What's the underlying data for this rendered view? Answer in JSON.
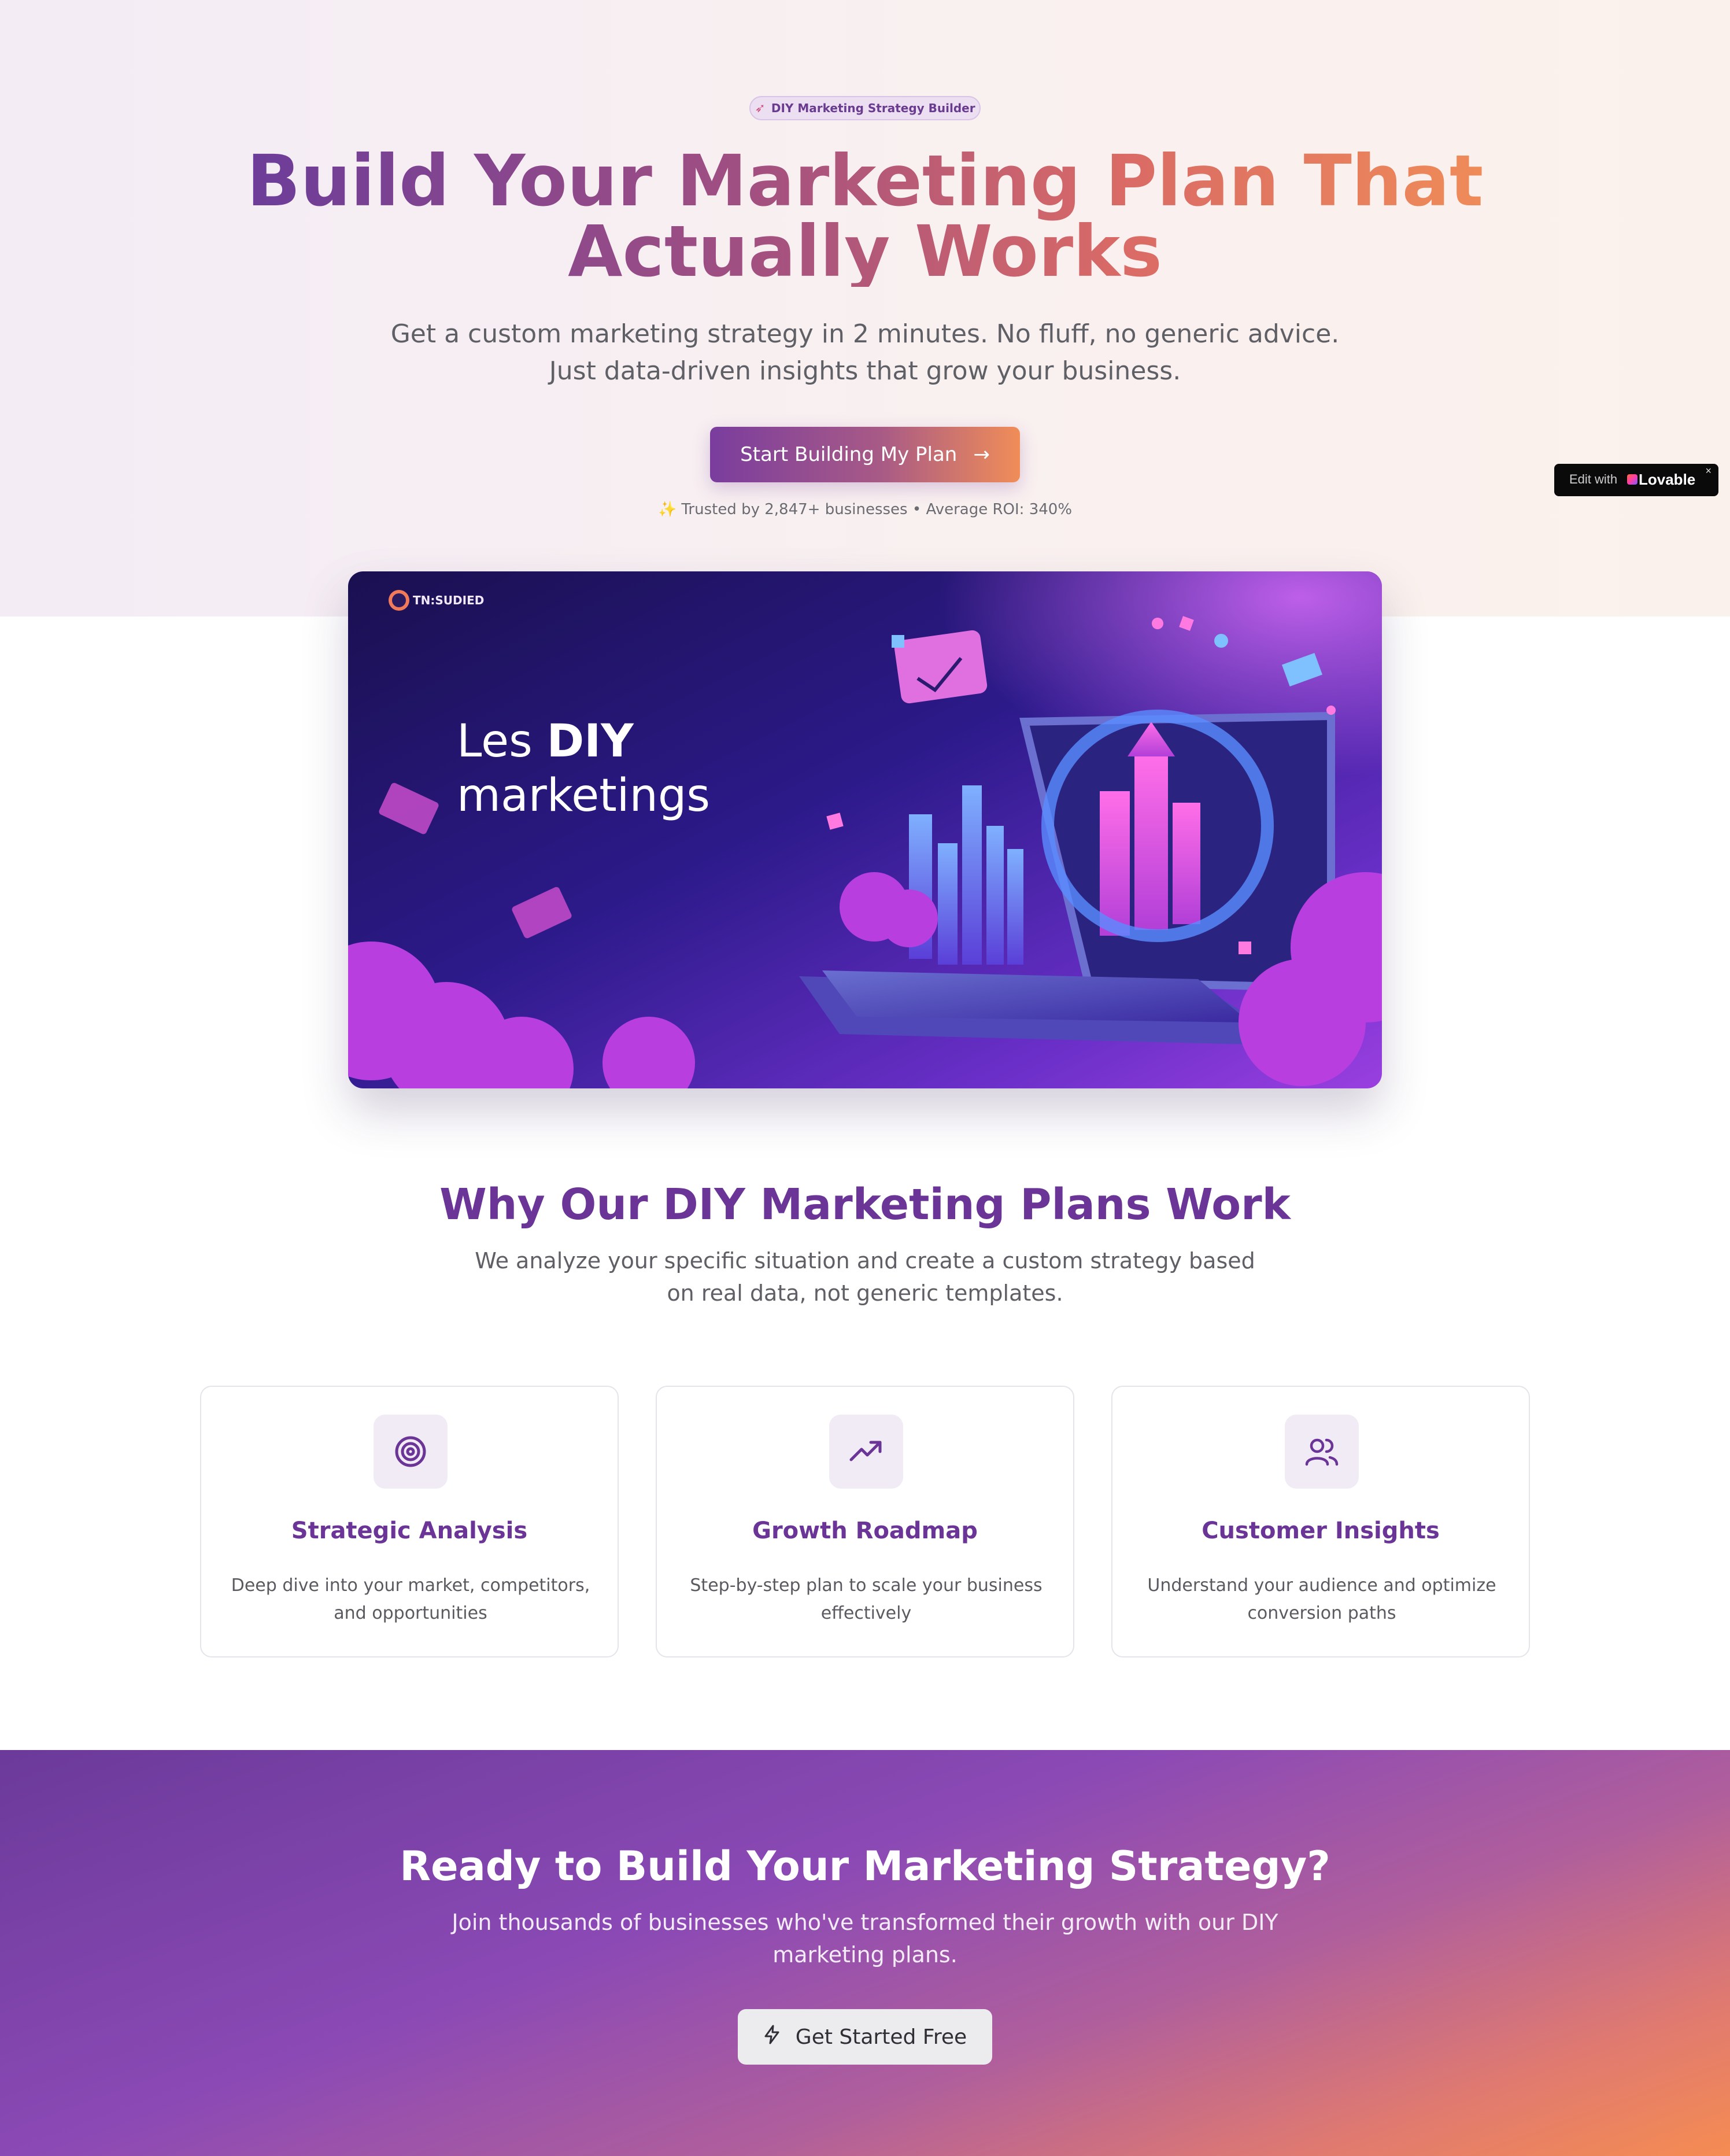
{
  "hero": {
    "badge_label": "DIY Marketing Strategy Builder",
    "title_line1": "Build Your Marketing Plan That",
    "title_line2": "Actually Works",
    "subtitle_line1": "Get a custom marketing strategy in 2 minutes. No fluff, no generic advice.",
    "subtitle_line2": "Just data-driven insights that grow your business.",
    "cta_label": "Start Building My Plan",
    "trust_text": "Trusted by 2,847+ businesses • Average ROI: 340%"
  },
  "edit_badge": {
    "prefix": "Edit with",
    "brand": "Lovable",
    "close": "×"
  },
  "banner": {
    "logo_text": "TN:SUDIED",
    "headline_prefix": "Les ",
    "headline_bold": "DIY",
    "headline_line2": "marketings"
  },
  "why": {
    "title": "Why Our DIY Marketing Plans Work",
    "subtitle": "We analyze your specific situation and create a custom strategy based on real data, not generic templates.",
    "cards": [
      {
        "icon": "target-icon",
        "title": "Strategic Analysis",
        "text": "Deep dive into your market, competitors, and opportunities"
      },
      {
        "icon": "trending-up-icon",
        "title": "Growth Roadmap",
        "text": "Step-by-step plan to scale your business effectively"
      },
      {
        "icon": "users-icon",
        "title": "Customer Insights",
        "text": "Understand your audience and optimize conversion paths"
      }
    ]
  },
  "cta": {
    "title": "Ready to Build Your Marketing Strategy?",
    "subtitle": "Join thousands of businesses who've transformed their growth with our DIY marketing plans.",
    "button_label": "Get Started Free"
  },
  "colors": {
    "primary": "#6a3596",
    "accent": "#f08d58"
  }
}
